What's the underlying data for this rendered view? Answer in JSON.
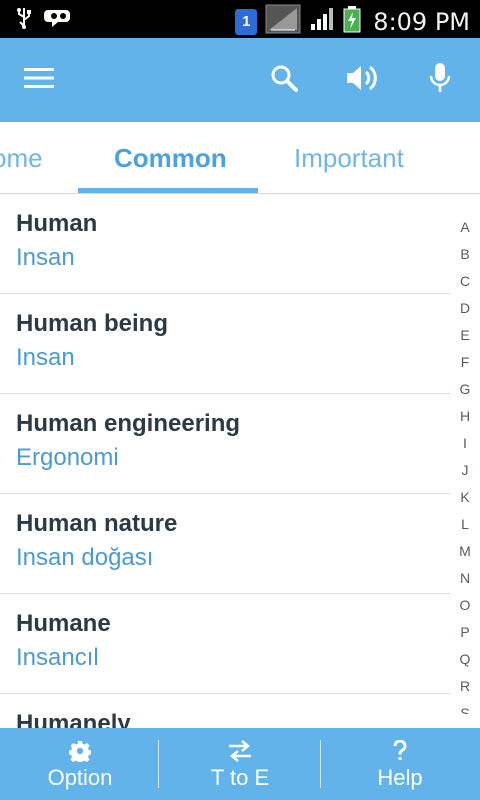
{
  "status_bar": {
    "time": "8:09 PM",
    "sim_slot": "1",
    "icons": [
      "usb-icon",
      "voicemail-icon",
      "sim-icon",
      "no-signal-icon",
      "signal-icon",
      "battery-charging-icon"
    ]
  },
  "app_bar": {
    "icons": [
      "menu-icon",
      "search-icon",
      "speaker-icon",
      "microphone-icon"
    ]
  },
  "tabs": [
    {
      "label": "ome",
      "active": false
    },
    {
      "label": "Common",
      "active": true
    },
    {
      "label": "Important",
      "active": false
    }
  ],
  "entries": [
    {
      "word": "Human",
      "meaning": "Insan"
    },
    {
      "word": "Human being",
      "meaning": "Insan"
    },
    {
      "word": "Human engineering",
      "meaning": "Ergonomi"
    },
    {
      "word": "Human nature",
      "meaning": "Insan doğası"
    },
    {
      "word": "Humane",
      "meaning": "Insancıl"
    },
    {
      "word": "Humanely",
      "meaning": ""
    }
  ],
  "alphabet": [
    "A",
    "B",
    "C",
    "D",
    "E",
    "F",
    "G",
    "H",
    "I",
    "J",
    "K",
    "L",
    "M",
    "N",
    "O",
    "P",
    "Q",
    "R",
    "S"
  ],
  "bottom_bar": {
    "option_label": "Option",
    "direction_label": "T to E",
    "help_label": "Help"
  },
  "colors": {
    "primary": "#62b3ea",
    "tab_text": "#4aa3df",
    "meaning_text": "#4a9bd1",
    "word_text": "#2b3a45"
  }
}
